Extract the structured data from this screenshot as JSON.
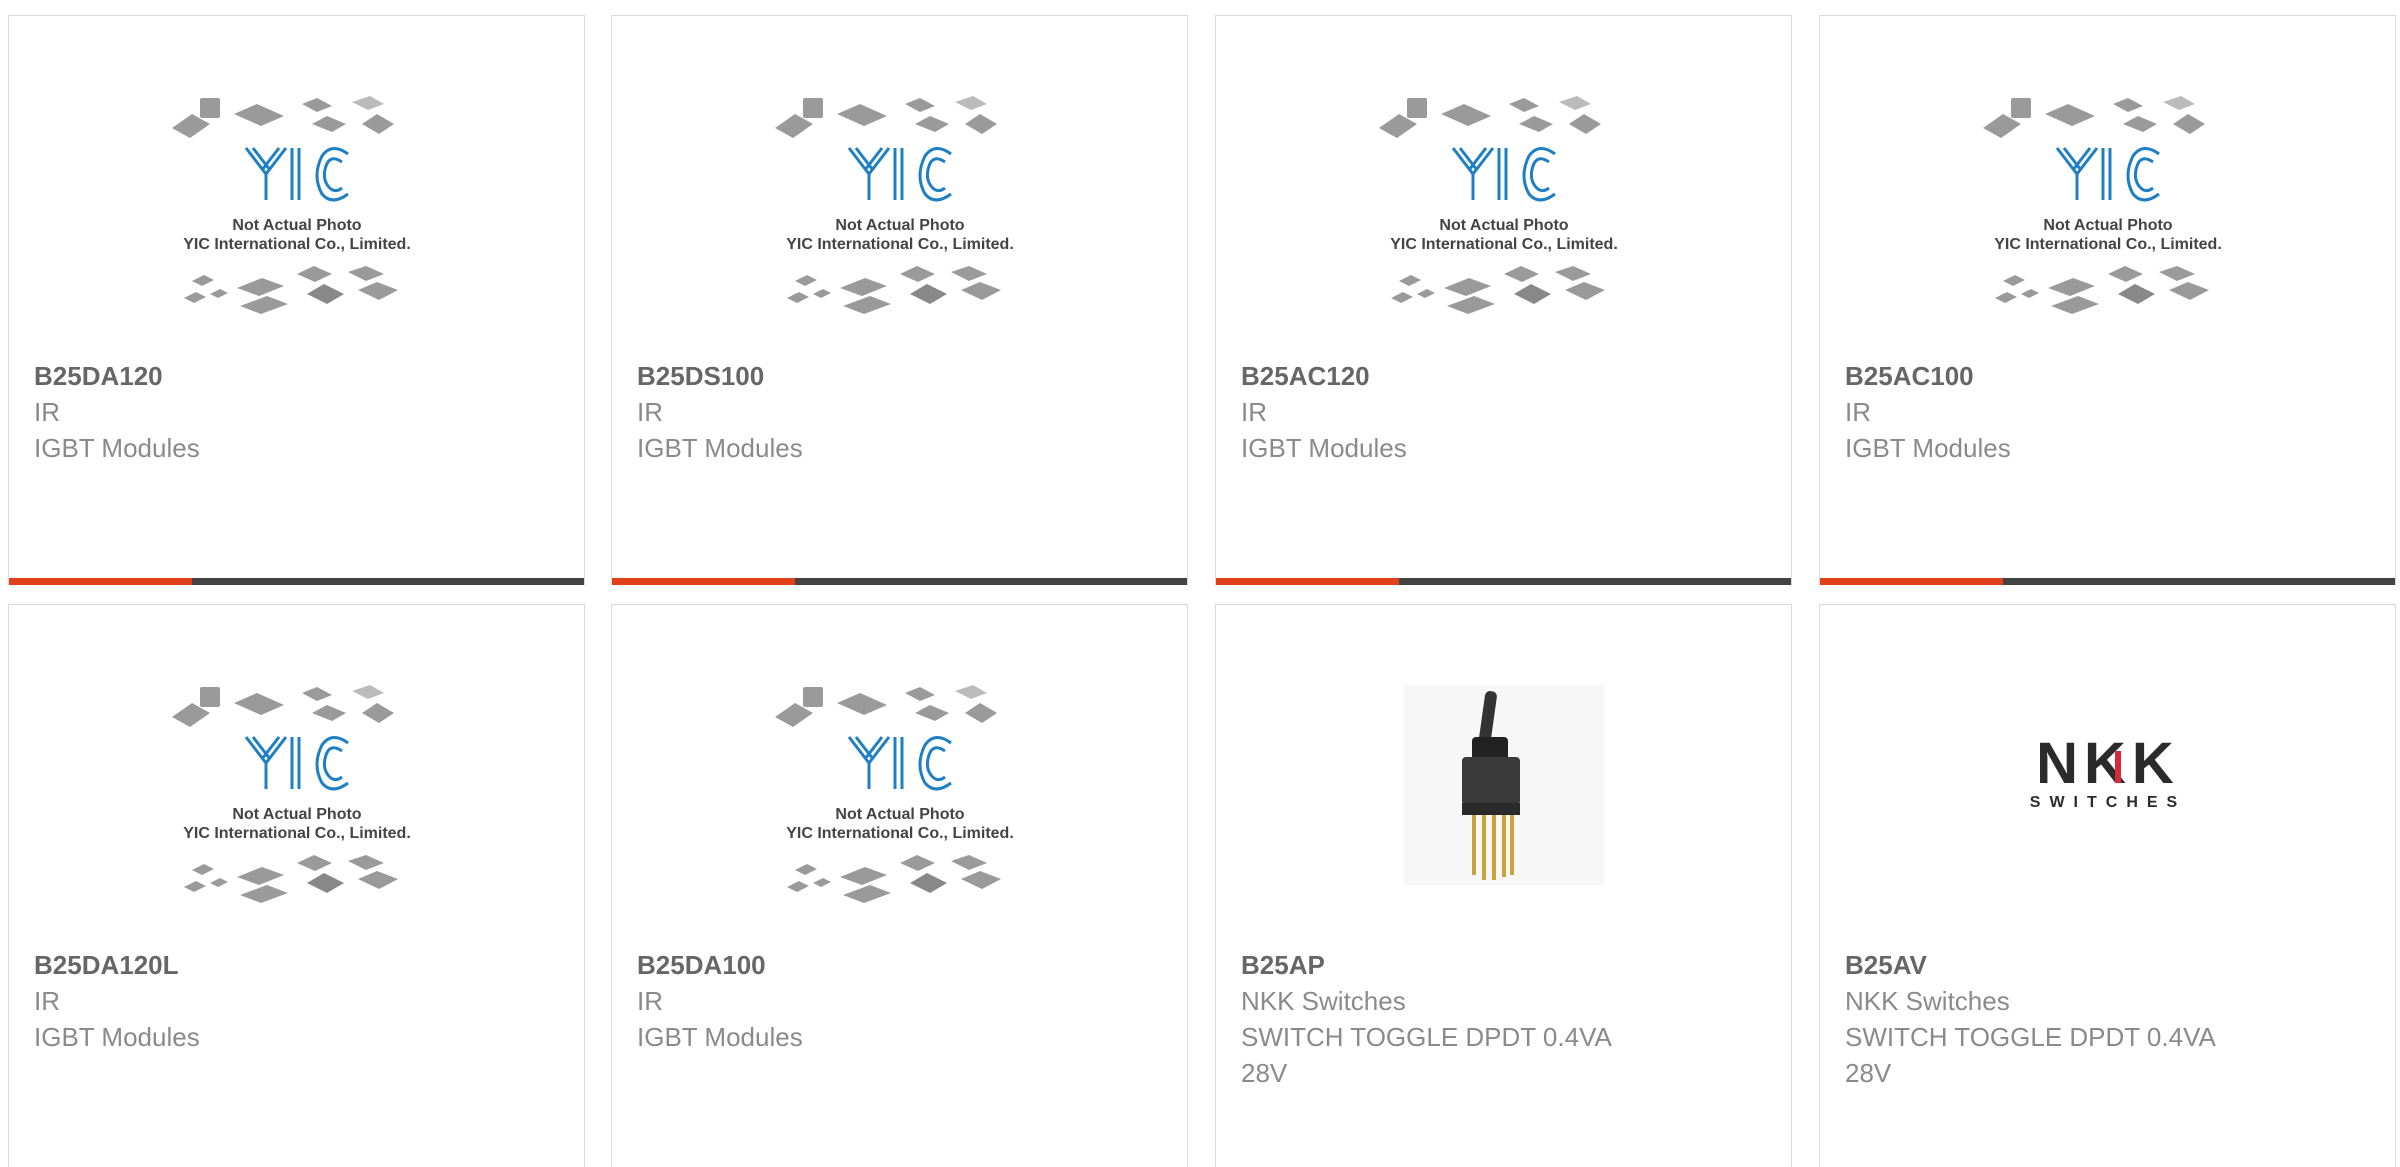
{
  "placeholder_text": {
    "line1": "Not Actual Photo",
    "line2": "YIC International Co., Limited.",
    "logo": "YIC"
  },
  "nkk_logo": {
    "brand": "NKK",
    "sub": "SWITCHES"
  },
  "colors": {
    "accent": "#e2401b",
    "bar": "#444444",
    "logo_blue": "#1f7fc4",
    "nkk_red": "#d42a3a"
  },
  "products": [
    {
      "part": "B25DA120",
      "manufacturer": "IR",
      "desc": "IGBT Modules",
      "image": "yic-placeholder"
    },
    {
      "part": "B25DS100",
      "manufacturer": "IR",
      "desc": "IGBT Modules",
      "image": "yic-placeholder"
    },
    {
      "part": "B25AC120",
      "manufacturer": "IR",
      "desc": "IGBT Modules",
      "image": "yic-placeholder"
    },
    {
      "part": "B25AC100",
      "manufacturer": "IR",
      "desc": "IGBT Modules",
      "image": "yic-placeholder"
    },
    {
      "part": "B25DA120L",
      "manufacturer": "IR",
      "desc": "IGBT Modules",
      "image": "yic-placeholder"
    },
    {
      "part": "B25DA100",
      "manufacturer": "IR",
      "desc": "IGBT Modules",
      "image": "yic-placeholder"
    },
    {
      "part": "B25AP",
      "manufacturer": "NKK Switches",
      "desc": "SWITCH TOGGLE DPDT 0.4VA",
      "desc2": "28V",
      "image": "toggle-switch-photo"
    },
    {
      "part": "B25AV",
      "manufacturer": "NKK Switches",
      "desc": "SWITCH TOGGLE DPDT 0.4VA",
      "desc2": "28V",
      "image": "nkk-logo"
    }
  ]
}
